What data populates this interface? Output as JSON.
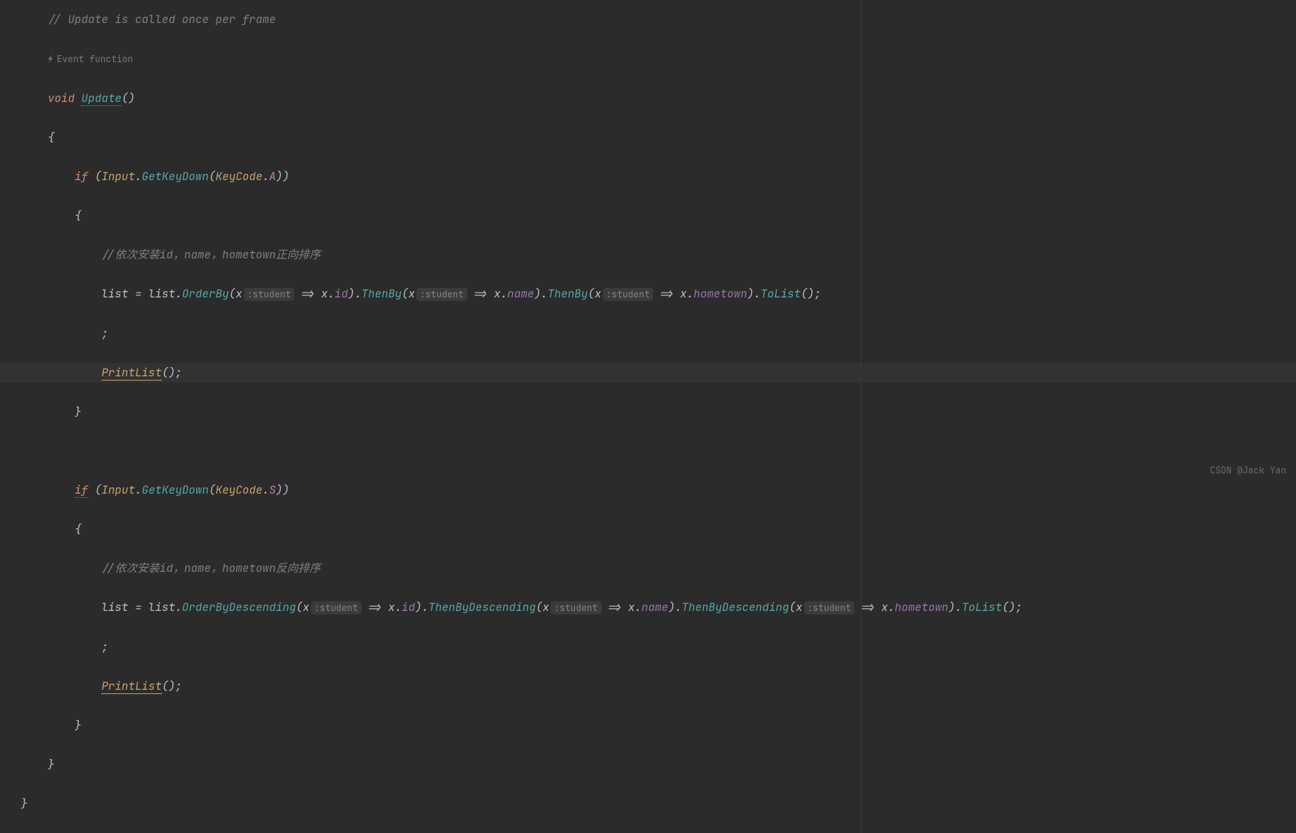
{
  "comment_update": "// Update is called once per frame",
  "event_hint": "Event function",
  "kw_void": "void",
  "fn_update": "Update",
  "kw_if": "if",
  "input_class": "Input",
  "getkeydown": "GetKeyDown",
  "keycode": "KeyCode",
  "key_a": "A",
  "key_s": "S",
  "comment_sort_asc": "//依次安装id，name，hometown正向排序",
  "comment_sort_desc": "//依次安装id，name，hometown反向排序",
  "list": "list",
  "assign": " = ",
  "orderby": "OrderBy",
  "orderbydesc": "OrderByDescending",
  "thenby": "ThenBy",
  "thenbydesc": "ThenByDescending",
  "tolist": "ToList",
  "lambda_x": "x",
  "param_student": ":student",
  "arrow": " => ",
  "field_id": "id",
  "field_name": "name",
  "field_hometown": "hometown",
  "semicolon_alone": ";",
  "printlist": "PrintList",
  "watermark": "CSDN @Jack Yan"
}
